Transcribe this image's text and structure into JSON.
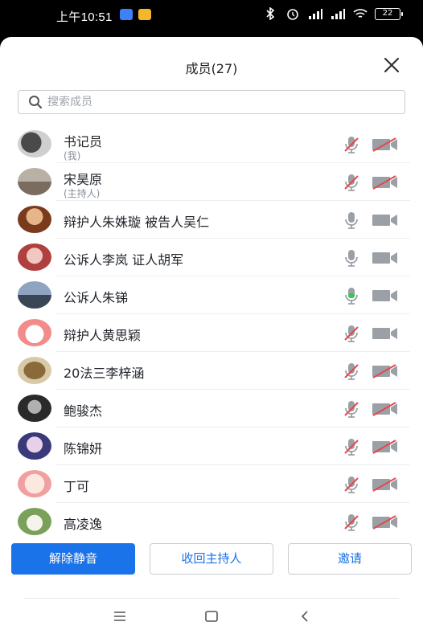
{
  "status_bar": {
    "time": "上午10:51",
    "battery": "22"
  },
  "sheet": {
    "title": "成员(27)",
    "search_placeholder": "搜索成员"
  },
  "members": [
    {
      "name": "书记员",
      "sub": "(我)",
      "mic": "muted",
      "camera": "off"
    },
    {
      "name": "宋昊原",
      "sub": "(主持人)",
      "mic": "muted",
      "camera": "off"
    },
    {
      "name": "辩护人朱姝璇 被告人吴仁",
      "sub": "",
      "mic": "on",
      "camera": "on"
    },
    {
      "name": "公诉人李岚 证人胡军",
      "sub": "",
      "mic": "on",
      "camera": "on"
    },
    {
      "name": "公诉人朱锑",
      "sub": "",
      "mic": "speaking",
      "camera": "on"
    },
    {
      "name": "辩护人黄思颖",
      "sub": "",
      "mic": "muted",
      "camera": "on"
    },
    {
      "name": "20法三李梓涵",
      "sub": "",
      "mic": "muted",
      "camera": "off"
    },
    {
      "name": "鲍骏杰",
      "sub": "",
      "mic": "muted",
      "camera": "off"
    },
    {
      "name": "陈锦妍",
      "sub": "",
      "mic": "muted",
      "camera": "off"
    },
    {
      "name": "丁可",
      "sub": "",
      "mic": "muted",
      "camera": "off"
    },
    {
      "name": "高凌逸",
      "sub": "",
      "mic": "muted",
      "camera": "off"
    }
  ],
  "buttons": {
    "unmute_all": "解除静音",
    "reclaim_host": "收回主持人",
    "invite": "邀请"
  },
  "colors": {
    "accent": "#1a73e8",
    "icon_gray": "#9aa0a6",
    "muted_red": "#e5484d",
    "speaking_green": "#34c759"
  }
}
